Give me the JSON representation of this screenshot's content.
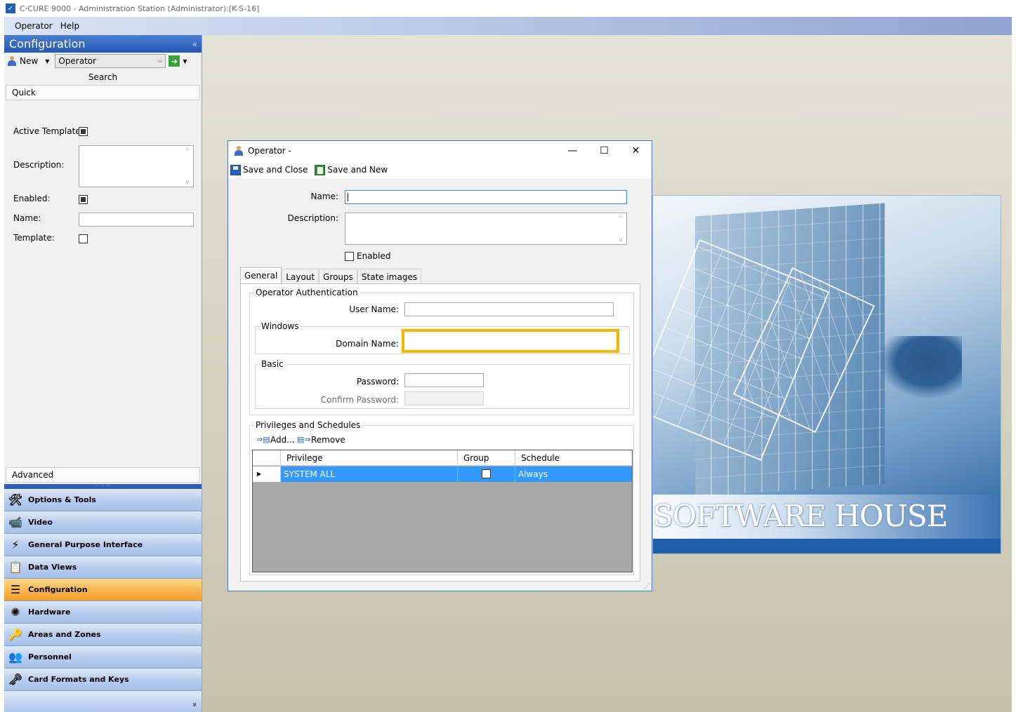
{
  "window": {
    "title": "C·CURE 9000 - Administration Station (Administrator):[K-S-16]"
  },
  "menu": [
    "Operator",
    "Help"
  ],
  "left_panel": {
    "header": "Configuration",
    "collapse_glyph": "«",
    "new_label": "New",
    "type_selected": "Operator",
    "search_label": "Search",
    "quick_label": "Quick",
    "fields": {
      "active_template": "Active Template:",
      "description": "Description:",
      "enabled": "Enabled:",
      "name": "Name:",
      "template": "Template:"
    },
    "advanced_label": "Advanced",
    "nav": [
      {
        "label": "Options & Tools",
        "icon": "tools-icon"
      },
      {
        "label": "Video",
        "icon": "video-icon"
      },
      {
        "label": "General Purpose Interface",
        "icon": "lightning-icon"
      },
      {
        "label": "Data Views",
        "icon": "data-views-icon"
      },
      {
        "label": "Configuration",
        "icon": "configuration-icon"
      },
      {
        "label": "Hardware",
        "icon": "hardware-icon"
      },
      {
        "label": "Areas and Zones",
        "icon": "key-icon"
      },
      {
        "label": "Personnel",
        "icon": "personnel-icon"
      },
      {
        "label": "Card Formats and Keys",
        "icon": "card-key-icon"
      }
    ],
    "nav_footer_glyph": "»"
  },
  "dialog": {
    "title": "Operator  -",
    "controls": {
      "minimize": "—",
      "maximize": "☐",
      "close": "✕"
    },
    "save_close": "Save and Close",
    "save_new": "Save and New",
    "name_label": "Name:",
    "description_label": "Description:",
    "enabled_label": "Enabled",
    "tabs": [
      "General",
      "Layout",
      "Groups",
      "State images"
    ],
    "auth_group": "Operator Authentication",
    "user_name_label": "User Name:",
    "windows_group": "Windows",
    "domain_name_label": "Domain Name:",
    "basic_group": "Basic",
    "password_label": "Password:",
    "confirm_password_label": "Confirm Password:",
    "privileges_group": "Privileges and Schedules",
    "add_label": "Add...",
    "remove_label": "Remove",
    "grid": {
      "columns": [
        "Privilege",
        "Group",
        "Schedule"
      ],
      "rows": [
        {
          "privilege": "SYSTEM ALL",
          "group": false,
          "schedule": "Always"
        }
      ]
    }
  },
  "splash": {
    "brand": "SOFTWARE HOUSE"
  },
  "colors": {
    "accent": "#3399ff",
    "highlight": "#f5b800",
    "nav_active": "#f7b34a"
  }
}
